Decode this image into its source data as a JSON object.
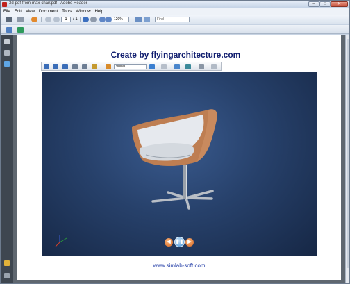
{
  "window": {
    "title": "3d-pdf-from-max-chair.pdf - Adobe Reader",
    "min_glyph": "–",
    "max_glyph": "□",
    "close_glyph": "✕"
  },
  "menu": [
    "File",
    "Edit",
    "View",
    "Document",
    "Tools",
    "Window",
    "Help"
  ],
  "toolbar": {
    "page_current": "1",
    "page_total": "/ 1",
    "zoom": "120%",
    "find_placeholder": "Find"
  },
  "document": {
    "title": "Create by flyingarchitecture.com",
    "footer": "www.simlab-soft.com"
  },
  "toolbar3d": {
    "views_label": "Views"
  },
  "playback": {
    "prev_glyph": "◀",
    "pause_glyph": "❚❚",
    "next_glyph": "▶"
  },
  "colors": {
    "title_color": "#0f1c6e",
    "link_color": "#1f3aa5",
    "viewport_bg": "#27416b",
    "chair_shell": "#c98a5e",
    "chair_seat": "#e6e9ee"
  }
}
